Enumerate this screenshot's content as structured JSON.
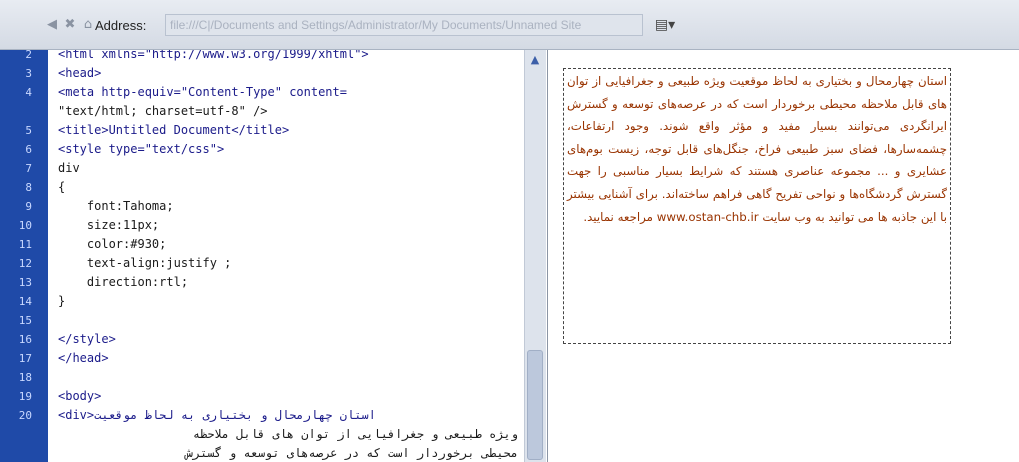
{
  "toolbar": {
    "back_icon": "back-arrow-icon",
    "stop_icon": "stop-icon",
    "home_icon": "home-icon",
    "address_label": "Address:",
    "address_value": "file:///C|/Documents and Settings/Administrator/My Documents/Unnamed Site",
    "view_icon": "view-options-icon"
  },
  "code": {
    "lines": [
      {
        "n": "2",
        "text": "<html xmlns=\"http://www.w3.org/1999/xhtml\">"
      },
      {
        "n": "3",
        "text": "<head>"
      },
      {
        "n": "4",
        "text": "<meta http-equiv=\"Content-Type\" content="
      },
      {
        "n": "",
        "text": "\"text/html; charset=utf-8\" />"
      },
      {
        "n": "5",
        "text": "<title>Untitled Document</title>"
      },
      {
        "n": "6",
        "text": "<style type=\"text/css\">"
      },
      {
        "n": "7",
        "text": "div"
      },
      {
        "n": "8",
        "text": "{"
      },
      {
        "n": "9",
        "text": "    font:Tahoma;"
      },
      {
        "n": "10",
        "text": "    size:11px;"
      },
      {
        "n": "11",
        "text": "    color:#930;"
      },
      {
        "n": "12",
        "text": "    text-align:justify ;"
      },
      {
        "n": "13",
        "text": "    direction:rtl;"
      },
      {
        "n": "14",
        "text": "}"
      },
      {
        "n": "15",
        "text": ""
      },
      {
        "n": "16",
        "text": "</style>"
      },
      {
        "n": "17",
        "text": "</head>"
      },
      {
        "n": "18",
        "text": ""
      },
      {
        "n": "19",
        "text": "<body>"
      },
      {
        "n": "20",
        "text": "<div>استان چهارمحال و بختیاری به لحاظ موقعیت"
      }
    ],
    "wrapped_rtl": [
      "ویژه طبیعی و جغرافیایی از توان های قابل ملاحظه",
      "محیطی برخوردار است که در عرصه‌های توسعه و گسترش",
      "ایرانگردی می‌توانند بسیار مفید و مؤثر واقع"
    ]
  },
  "design": {
    "text": "استان چهارمحال و بختیاری به لحاظ موقعیت ویژه طبیعی و جغرافیایی از توان های قابل ملاحظه محیطی برخوردار است که در عرصه‌های توسعه و گسترش ایرانگردی می‌توانند بسیار مفید و مؤثر واقع شوند. وجود ارتفاعات، چشمه‌سارها، فضای سبز طبیعی فراخ، جنگل‌های قابل توجه، زیست بوم‌های عشایری و ... مجموعه عناصری هستند که شرایط بسیار مناسبی را جهت گسترش گردشگاه‌ها و نواحی تفریح گاهی فراهم ساخته‌اند. برای آشنایی بیشتر با این جاذبه ها می توانید به وب سایت www.ostan-chb.ir مراجعه نمایید."
  }
}
